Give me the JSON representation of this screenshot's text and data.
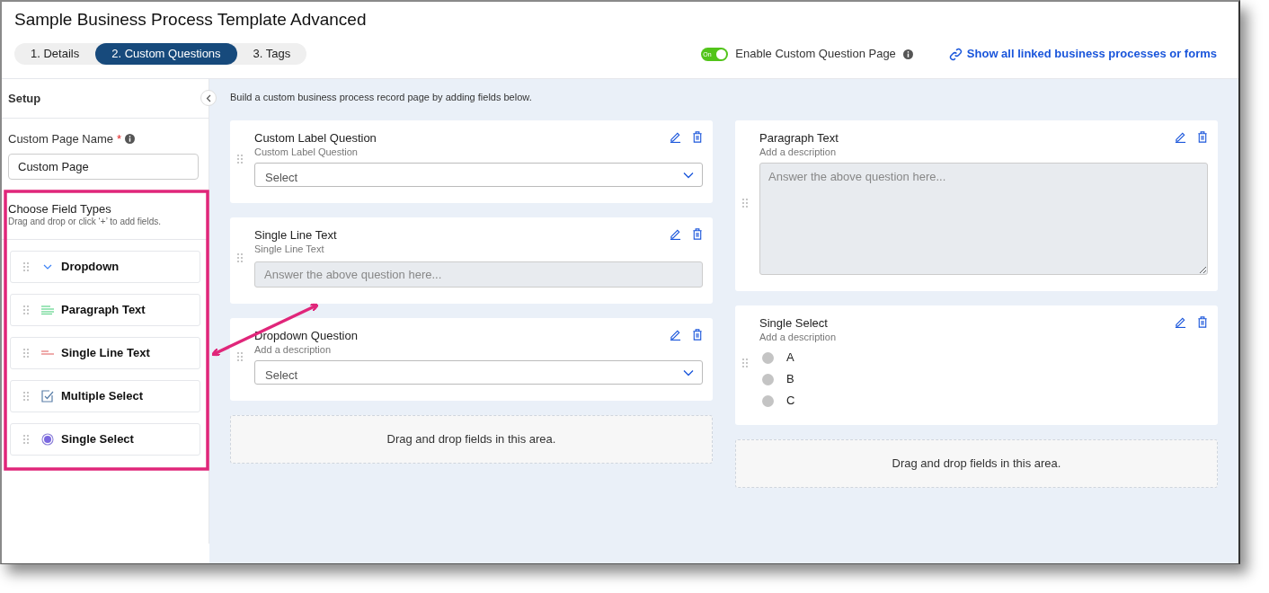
{
  "title": "Sample Business Process Template Advanced",
  "tabs": [
    {
      "label": "1. Details",
      "selected": false
    },
    {
      "label": "2. Custom Questions",
      "selected": true
    },
    {
      "label": "3. Tags",
      "selected": false
    }
  ],
  "toggle": {
    "label": "Enable Custom Question Page",
    "on_label": "On",
    "on": true
  },
  "link": "Show all linked business processes or forms",
  "sidebar": {
    "title": "Setup",
    "page_name_label": "Custom Page Name",
    "required_mark": "*",
    "page_name": "Custom Page",
    "field_types_title": "Choose Field Types",
    "field_types_hint": "Drag and drop or click ‘+’ to add fields.",
    "items": [
      {
        "label": "Dropdown",
        "kind": "dropdown"
      },
      {
        "label": "Paragraph Text",
        "kind": "paragraph"
      },
      {
        "label": "Single Line Text",
        "kind": "line"
      },
      {
        "label": "Multiple Select",
        "kind": "multiple"
      },
      {
        "label": "Single Select",
        "kind": "single"
      }
    ]
  },
  "intro": "Build a custom business process record page by adding fields below.",
  "columns": [
    [
      {
        "kind": "select",
        "title": "Custom Label Question",
        "description": "Custom Label Question",
        "placeholder": "Select"
      },
      {
        "kind": "text",
        "title": "Single Line Text",
        "description": "Single Line Text",
        "placeholder": "Answer the above question here..."
      },
      {
        "kind": "select",
        "title": "Dropdown Question",
        "description": "Add a description",
        "placeholder": "Select"
      },
      {
        "kind": "dropzone",
        "text": "Drag and drop fields in this area."
      }
    ],
    [
      {
        "kind": "textarea",
        "title": "Paragraph Text",
        "description": "Add a description",
        "placeholder": "Answer the above question here..."
      },
      {
        "kind": "radio",
        "title": "Single Select",
        "description": "Add a description",
        "options": [
          {
            "label": "A",
            "selected": false
          },
          {
            "label": "B",
            "selected": false
          },
          {
            "label": "C",
            "selected": false
          }
        ]
      },
      {
        "kind": "dropzone",
        "text": "Drag and drop fields in this area."
      }
    ]
  ]
}
